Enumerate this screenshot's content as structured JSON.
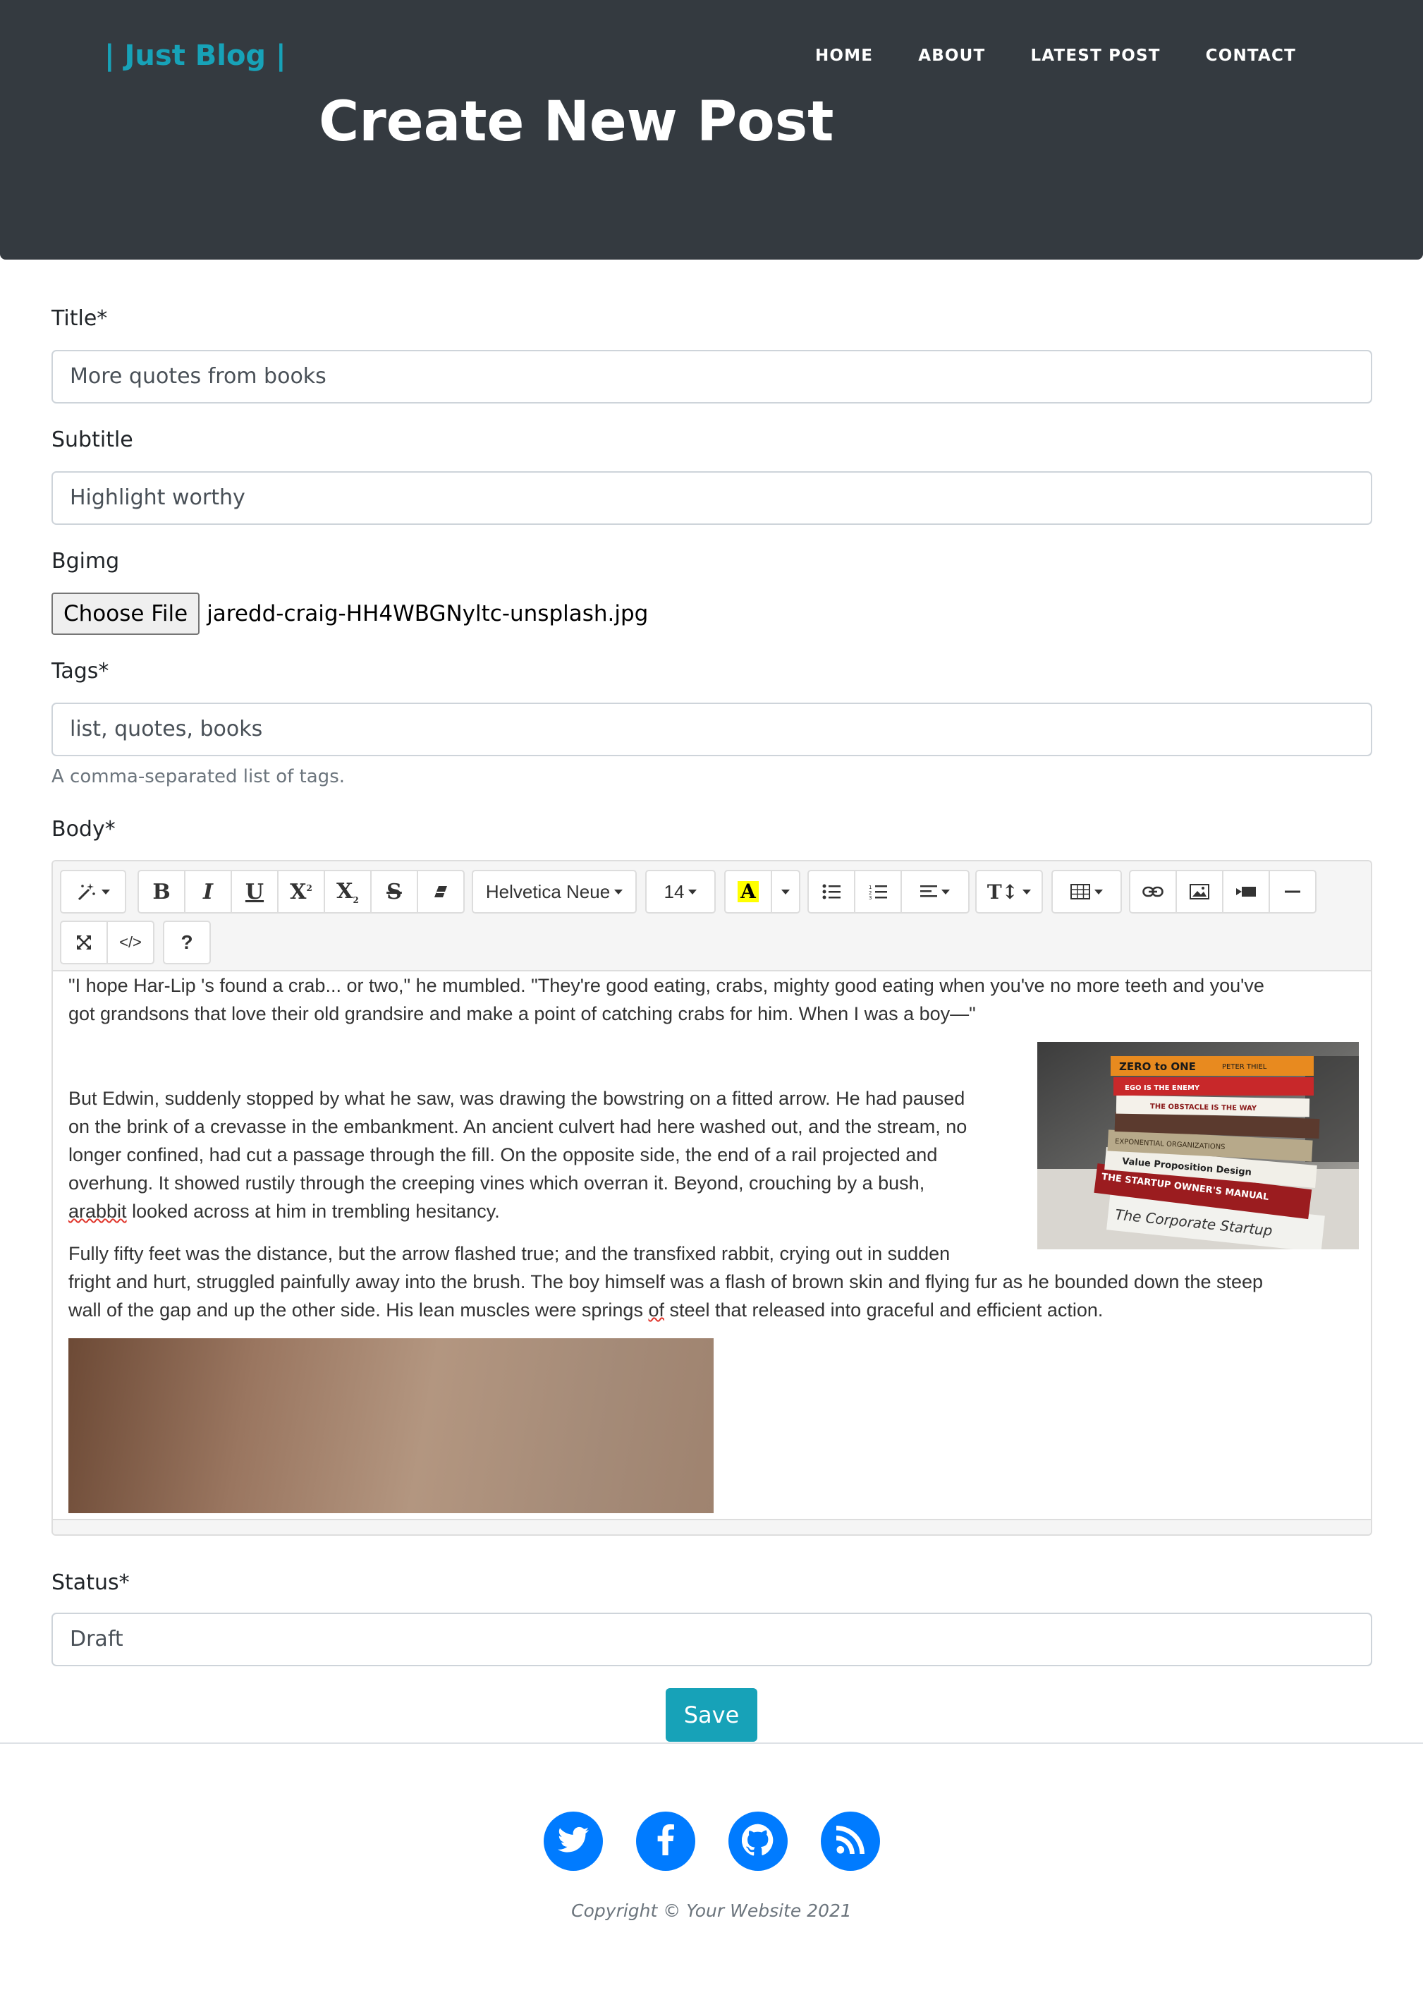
{
  "header": {
    "brand": "| Just Blog |",
    "nav": [
      "HOME",
      "ABOUT",
      "LATEST POST",
      "CONTACT"
    ],
    "heading": "Create New Post"
  },
  "form": {
    "title": {
      "label": "Title*",
      "value": "More quotes from books"
    },
    "subtitle": {
      "label": "Subtitle",
      "value": "Highlight worthy"
    },
    "bgimg": {
      "label": "Bgimg",
      "button": "Choose File",
      "filename": "jaredd-craig-HH4WBGNyltc-unsplash.jpg"
    },
    "tags": {
      "label": "Tags*",
      "value": "list, quotes, books",
      "help": "A comma-separated list of tags."
    },
    "body": {
      "label": "Body*",
      "toolbar": {
        "font_name": "Helvetica Neue",
        "font_size": "14",
        "icons": [
          "magic-icon",
          "bold-icon",
          "italic-icon",
          "underline-icon",
          "superscript-icon",
          "subscript-icon",
          "strikethrough-icon",
          "eraser-icon",
          "highlight-icon",
          "bullet-list-icon",
          "numbered-list-icon",
          "align-icon",
          "line-height-icon",
          "table-icon",
          "link-icon",
          "picture-icon",
          "video-icon",
          "horizontal-rule-icon",
          "fullscreen-icon",
          "code-view-icon",
          "help-icon"
        ]
      },
      "paragraphs": [
        "\"I hope Har-Lip 's found a crab... or two,\" he mumbled. \"They're good eating, crabs, mighty good eating when you've no more teeth and you've",
        "got grandsons that love their old grandsire and make a point of catching crabs for him. When I was a boy—\"",
        "But Edwin, suddenly stopped by what he saw, was drawing the bowstring on a fitted arrow. He had paused",
        "on the brink of a crevasse in the embankment. An ancient culvert had here washed out, and the stream, no",
        "longer confined, had cut a passage through the fill. On the opposite side, the end of a rail projected and",
        "overhung. It showed rustily through the creeping vines which overran it. Beyond, crouching by a bush,",
        " looked across at him in trembling hesitancy.",
        "Fully fifty feet was the distance, but the arrow flashed true; and the transfixed rabbit, crying out in sudden",
        "fright and hurt, struggled painfully away into the brush. The boy himself was a flash of brown skin and flying fur as he bounded down the steep",
        "wall of the gap and up the other side. His lean muscles were springs ",
        " steel that released into graceful and efficient action."
      ],
      "misspelled": [
        "arabbit",
        "of"
      ],
      "book_image": {
        "lines": [
          "ZERO to ONE",
          "PETER THIEL",
          "EGO IS THE ENEMY",
          "THE OBSTACLE IS THE WAY",
          "EXPONENTIAL ORGANIZATIONS",
          "Value Proposition Design",
          "THE STARTUP OWNER'S MANUAL",
          "The Corporate Startup"
        ]
      }
    },
    "status": {
      "label": "Status*",
      "value": "Draft"
    },
    "save": "Save"
  },
  "footer": {
    "social_icons": [
      "twitter-icon",
      "facebook-icon",
      "github-icon",
      "rss-icon"
    ],
    "copyright": "Copyright © Your Website 2021"
  },
  "colors": {
    "header_bg": "#343a40",
    "brand": "#17a2b8",
    "save_button": "#17a2b8",
    "social": "#007bff"
  }
}
